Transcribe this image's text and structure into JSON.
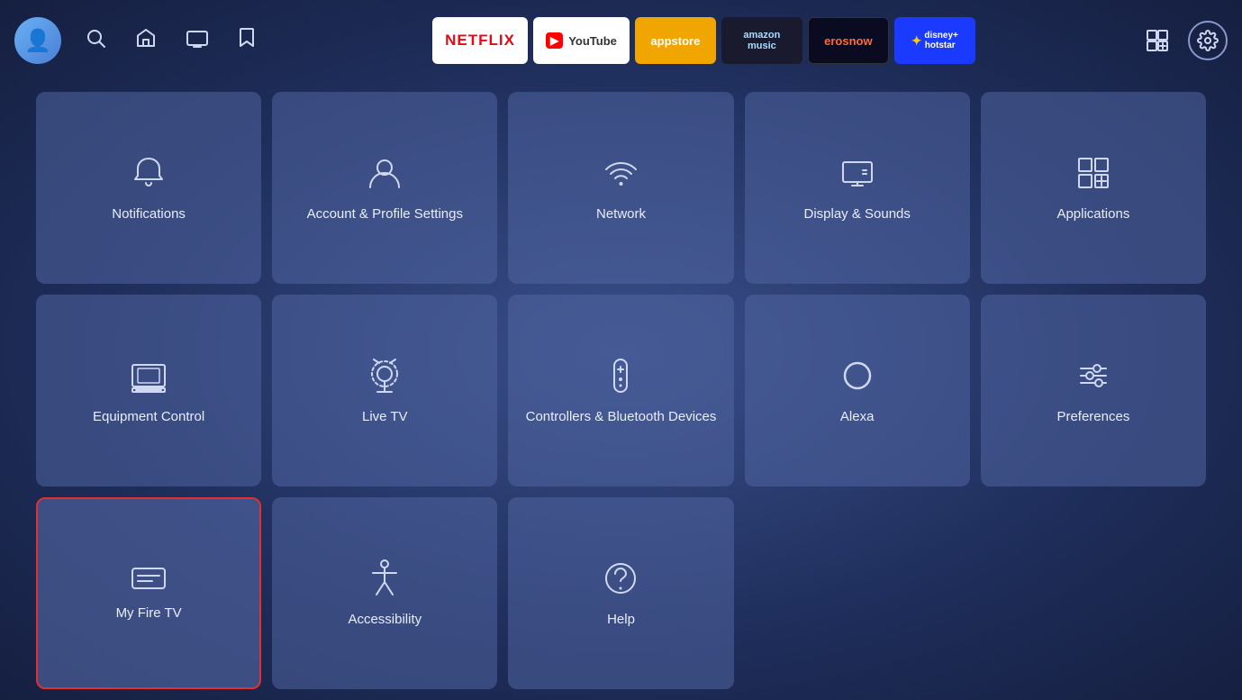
{
  "topbar": {
    "nav_icons": [
      "🔍",
      "🏠",
      "📺",
      "🔖"
    ],
    "apps": [
      {
        "label": "NETFLIX",
        "key": "netflix"
      },
      {
        "label": "YouTube",
        "key": "youtube"
      },
      {
        "label": "appstore",
        "key": "appstore"
      },
      {
        "label": "amazon music",
        "key": "amazonmusic"
      },
      {
        "label": "erosnow",
        "key": "erosnow"
      },
      {
        "label": "disney+ hotstar",
        "key": "hotstar"
      }
    ],
    "right_icons": [
      "grid-plus",
      "settings"
    ]
  },
  "tiles": [
    {
      "id": "notifications",
      "label": "Notifications",
      "icon": "bell"
    },
    {
      "id": "account-profile",
      "label": "Account & Profile Settings",
      "icon": "person"
    },
    {
      "id": "network",
      "label": "Network",
      "icon": "wifi"
    },
    {
      "id": "display-sounds",
      "label": "Display & Sounds",
      "icon": "display"
    },
    {
      "id": "applications",
      "label": "Applications",
      "icon": "grid-plus"
    },
    {
      "id": "equipment-control",
      "label": "Equipment Control",
      "icon": "monitor"
    },
    {
      "id": "live-tv",
      "label": "Live TV",
      "icon": "antenna"
    },
    {
      "id": "controllers-bluetooth",
      "label": "Controllers & Bluetooth Devices",
      "icon": "remote"
    },
    {
      "id": "alexa",
      "label": "Alexa",
      "icon": "alexa"
    },
    {
      "id": "preferences",
      "label": "Preferences",
      "icon": "sliders"
    },
    {
      "id": "my-fire-tv",
      "label": "My Fire TV",
      "icon": "firetv",
      "selected": true
    },
    {
      "id": "accessibility",
      "label": "Accessibility",
      "icon": "accessibility"
    },
    {
      "id": "help",
      "label": "Help",
      "icon": "help"
    },
    {
      "id": "empty1",
      "label": "",
      "icon": ""
    },
    {
      "id": "empty2",
      "label": "",
      "icon": ""
    }
  ]
}
